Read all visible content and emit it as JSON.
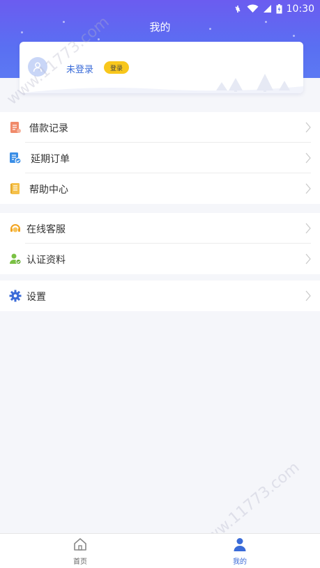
{
  "status_bar": {
    "time": "10:30"
  },
  "header": {
    "title": "我的"
  },
  "profile": {
    "status_text": "未登录",
    "login_label": "登录"
  },
  "menu_group_1": [
    {
      "label": "借款记录",
      "icon": "loan-record-icon",
      "color": "#f08a6a"
    },
    {
      "label": "延期订单",
      "icon": "extend-order-icon",
      "color": "#3a8ee6"
    },
    {
      "label": "帮助中心",
      "icon": "help-center-icon",
      "color": "#f5c04a"
    }
  ],
  "menu_group_2": [
    {
      "label": "在线客服",
      "icon": "customer-service-icon",
      "color": "#f2a21e"
    },
    {
      "label": "认证资料",
      "icon": "verification-icon",
      "color": "#7ac143"
    }
  ],
  "menu_group_3": [
    {
      "label": "设置",
      "icon": "settings-icon",
      "color": "#3a6bd8"
    }
  ],
  "tab_bar": {
    "home_label": "首页",
    "mine_label": "我的",
    "active_color": "#3a6bd8",
    "inactive_color": "#666666"
  },
  "watermark": "www.11773.com",
  "colors": {
    "brand_start": "#6b5cf0",
    "brand_end": "#5c79f3",
    "badge": "#f8c71c"
  }
}
